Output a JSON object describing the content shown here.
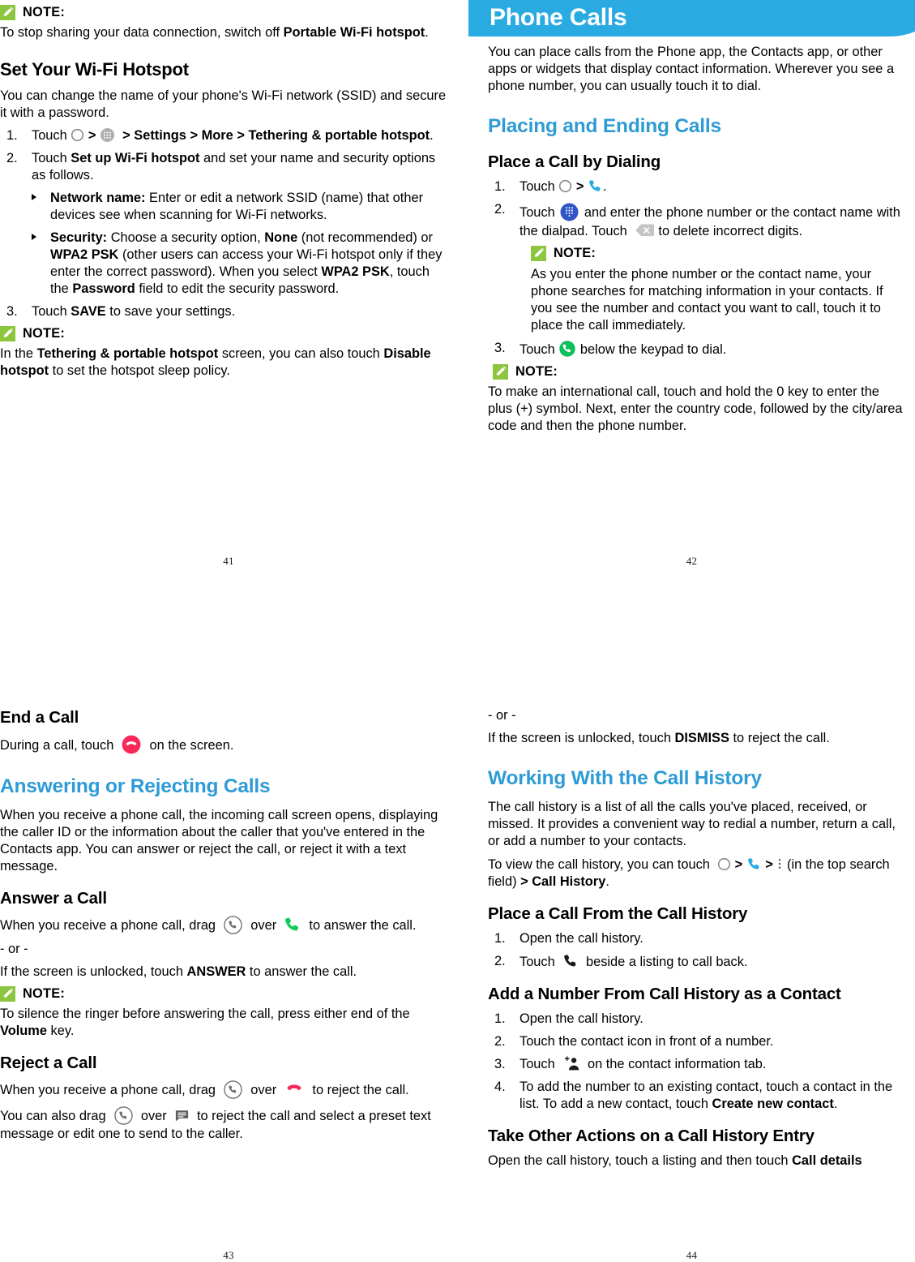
{
  "colors": {
    "chapter_banner_bg": "#29ABE2",
    "section_heading": "#2E9BD6",
    "note_icon_green": "#8CC63F",
    "phone_blue": "#29ABE2",
    "call_green": "#0BBF5B",
    "end_call_red": "#F8285A",
    "dialpad_blue": "#2F55C6",
    "delete_gray": "#BDBDBD"
  },
  "labels": {
    "note": "NOTE:"
  },
  "pages": {
    "p41": {
      "folio": "41",
      "note_top": {
        "label": "NOTE:",
        "text_pre": "To stop sharing your data connection, switch off ",
        "bold1": "Portable Wi-Fi hotspot",
        "text_post": "."
      },
      "heading": "Set Your Wi-Fi Hotspot",
      "intro": "You can change the name of your phone's Wi-Fi network (SSID) and secure it with a password.",
      "step1": {
        "num": "1.",
        "touch": "Touch",
        "gt1": ">",
        "gt2": ">",
        "bold_path": "Settings > More > Tethering & portable hotspot",
        "period": "."
      },
      "step2": {
        "num": "2.",
        "pre": "Touch ",
        "bold": "Set up Wi-Fi hotspot",
        "post": " and set your name and security options as follows."
      },
      "bullets": [
        {
          "bold": "Network name:",
          "text": " Enter or edit a network SSID (name) that other devices see when scanning for Wi-Fi networks."
        },
        {
          "seg": [
            {
              "t": "Security:",
              "b": true
            },
            {
              "t": " Choose a security option, ",
              "b": false
            },
            {
              "t": "None",
              "b": true
            },
            {
              "t": " (not recommended) or ",
              "b": false
            },
            {
              "t": "WPA2 PSK",
              "b": true
            },
            {
              "t": " (other users can access your Wi-Fi hotspot only if they enter the correct password). When you select ",
              "b": false
            },
            {
              "t": "WPA2 PSK",
              "b": true
            },
            {
              "t": ", touch the ",
              "b": false
            },
            {
              "t": "Password",
              "b": true
            },
            {
              "t": " field to edit the security password.",
              "b": false
            }
          ]
        }
      ],
      "step3": {
        "num": "3.",
        "pre": "Touch ",
        "bold": "SAVE",
        "post": " to save your settings."
      },
      "note_bottom": {
        "label": "NOTE:",
        "seg": [
          {
            "t": "In the ",
            "b": false
          },
          {
            "t": "Tethering & portable hotspot",
            "b": true
          },
          {
            "t": " screen, you can also touch ",
            "b": false
          },
          {
            "t": "Disable hotspot",
            "b": true
          },
          {
            "t": " to set the hotspot sleep policy.",
            "b": false
          }
        ]
      }
    },
    "p42": {
      "folio": "42",
      "chapter_title": "Phone Calls",
      "intro": "You can place calls from the Phone app, the Contacts app, or other apps or widgets that display contact information. Wherever you see a phone number, you can usually touch it to dial.",
      "section": "Placing and Ending Calls",
      "sub1": "Place a Call by Dialing",
      "step1": {
        "num": "1.",
        "touch": "Touch",
        "gt": ">",
        "period": "."
      },
      "step2": {
        "num": "2.",
        "pre": "Touch",
        "mid": "and enter the phone number or the contact name with the dialpad. Touch",
        "post": "to delete incorrect digits."
      },
      "note1": {
        "label": "NOTE:",
        "text": "As you enter the phone number or the contact name, your phone searches for matching information in your contacts. If you see the number and contact you want to call, touch it to place the call immediately."
      },
      "step3": {
        "num": "3.",
        "pre": "Touch",
        "post": "below the keypad to dial."
      },
      "note2": {
        "label": "NOTE:",
        "text": "To make an international call, touch and hold the 0 key to enter the plus (+) symbol. Next, enter the country code, followed by the city/area code and then the phone number."
      }
    },
    "p43": {
      "folio": "43",
      "sub_end": "End a Call",
      "end_text": {
        "pre": "During a call, touch",
        "post": "on the screen."
      },
      "section": "Answering or Rejecting Calls",
      "intro": "When you receive a phone call, the incoming call screen opens, displaying the caller ID or the information about the caller that you've entered in the Contacts app. You can answer or reject the call, or reject it with a text message.",
      "sub_answer": "Answer a Call",
      "answer_text": {
        "pre": "When you receive a phone call, drag",
        "mid": "over",
        "post": "to answer the call."
      },
      "or": "- or -",
      "unlocked_answer": {
        "pre": "If the screen is unlocked, touch ",
        "bold": "ANSWER",
        "post": " to answer the call."
      },
      "note": {
        "label": "NOTE:",
        "seg": [
          {
            "t": "To silence the ringer before answering the call, press either end of the ",
            "b": false
          },
          {
            "t": "Volume",
            "b": true
          },
          {
            "t": " key.",
            "b": false
          }
        ]
      },
      "sub_reject": "Reject a Call",
      "reject_text": {
        "pre": "When you receive a phone call, drag",
        "mid": "over",
        "post": "to reject the call."
      },
      "reject_text2": {
        "pre": "You can also drag",
        "mid": "over",
        "post": "to reject the call and select a preset text message or edit one to send to the caller."
      }
    },
    "p44": {
      "folio": "44",
      "or": "- or -",
      "unlocked_dismiss": {
        "pre": "If the screen is unlocked, touch ",
        "bold": "DISMISS",
        "post": " to reject the call."
      },
      "section": "Working With the Call History",
      "intro": "The call history is a list of all the calls you've placed, received, or missed. It provides a convenient way to redial a number, return a call, or add a number to your contacts.",
      "view_line": {
        "pre": "To view the call history, you can touch",
        "gt1": ">",
        "gt2": ">",
        "mid": "(in the top search field)",
        "bold": "> Call History",
        "post": "."
      },
      "sub_place": "Place a Call From the Call History",
      "place_steps": [
        {
          "num": "1.",
          "text": "Open the call history."
        },
        {
          "num": "2.",
          "pre": "Touch",
          "post": "beside a listing to call back."
        }
      ],
      "sub_add": "Add a Number From Call History as a Contact",
      "add_steps": [
        {
          "num": "1.",
          "text": "Open the call history."
        },
        {
          "num": "2.",
          "text": "Touch the contact icon in front of a number."
        },
        {
          "num": "3.",
          "pre": "Touch",
          "post": "on the contact information tab."
        },
        {
          "num": "4.",
          "seg": [
            {
              "t": "To add the number to an existing contact, touch a contact in the list. To add a new contact, touch ",
              "b": false
            },
            {
              "t": "Create new contact",
              "b": true
            },
            {
              "t": ".",
              "b": false
            }
          ]
        }
      ],
      "sub_other": "Take Other Actions on a Call History Entry",
      "other_text": {
        "seg": [
          {
            "t": "Open the call history, touch a listing and then touch ",
            "b": false
          },
          {
            "t": "Call details",
            "b": true
          }
        ]
      }
    }
  }
}
